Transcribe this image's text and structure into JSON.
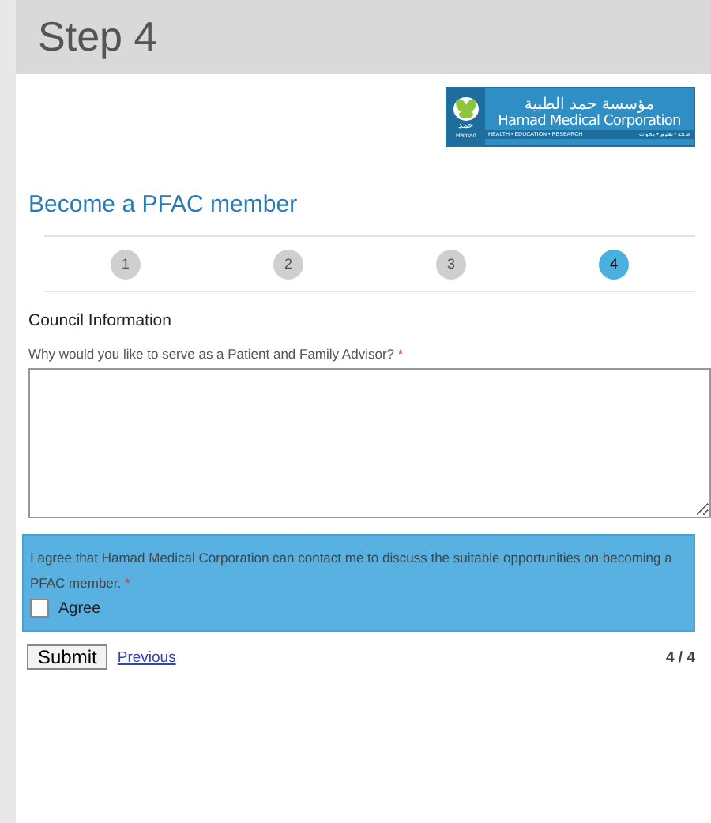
{
  "header": {
    "title": "Step 4"
  },
  "logo": {
    "arabic_name": "مؤسسة حمد الطبية",
    "english_name": "Hamad Medical Corporation",
    "emblem_arabic": "حمد",
    "emblem_english": "Hamad",
    "tagline": "HEALTH • EDUCATION • RESEARCH",
    "tagline_arabic": "صحة • تعليم • بحوث"
  },
  "form_title": "Become a PFAC member",
  "steps": [
    {
      "label": "1",
      "selected": false
    },
    {
      "label": "2",
      "selected": false
    },
    {
      "label": "3",
      "selected": false
    },
    {
      "label": "4",
      "selected": true
    }
  ],
  "section_title": "Council Information",
  "question": {
    "label": "Why would you like to serve as a Patient and Family Advisor?",
    "required_mark": "*"
  },
  "consent": {
    "text": "I agree that Hamad Medical Corporation can contact me to discuss the suitable opportunities on becoming a PFAC member.",
    "required_mark": "*",
    "option": "Agree",
    "checked": false
  },
  "submit": "Submit",
  "previous": "Previous",
  "page_count": "4 / 4"
}
